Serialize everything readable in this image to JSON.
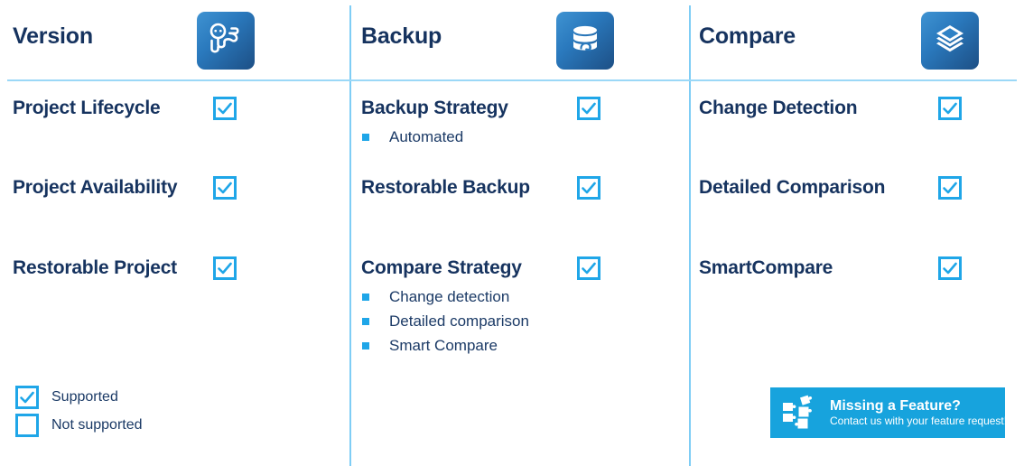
{
  "theme": {
    "heading_color": "#16335f",
    "accent_blue": "#1fa6e8",
    "divider_blue": "#7fcdf5",
    "banner_bg": "#17a3dd",
    "icon_gradient_from": "#3f93d2",
    "icon_gradient_to": "#1d4f85"
  },
  "columns": [
    {
      "title": "Version",
      "icon": "version-branch-icon",
      "features": [
        {
          "label": "Project Lifecycle",
          "supported": true,
          "subitems": []
        },
        {
          "label": "Project Availability",
          "supported": true,
          "subitems": []
        },
        {
          "label": "Restorable Project",
          "supported": true,
          "subitems": []
        }
      ]
    },
    {
      "title": "Backup",
      "icon": "database-backup-icon",
      "features": [
        {
          "label": "Backup Strategy",
          "supported": true,
          "subitems": [
            "Automated"
          ]
        },
        {
          "label": "Restorable Backup",
          "supported": true,
          "subitems": []
        },
        {
          "label": "Compare Strategy",
          "supported": true,
          "subitems": [
            "Change detection",
            "Detailed comparison",
            "Smart Compare"
          ]
        }
      ]
    },
    {
      "title": "Compare",
      "icon": "layers-stack-icon",
      "features": [
        {
          "label": "Change Detection",
          "supported": true,
          "subitems": []
        },
        {
          "label": "Detailed Comparison",
          "supported": true,
          "subitems": []
        },
        {
          "label": "SmartCompare",
          "supported": true,
          "subitems": []
        }
      ]
    }
  ],
  "legend": [
    {
      "label": "Supported",
      "checked": true
    },
    {
      "label": "Not supported",
      "checked": false
    }
  ],
  "banner": {
    "icon": "puzzle-pieces-icon",
    "title": "Missing a Feature?",
    "subtitle": "Contact us with your feature request!"
  }
}
